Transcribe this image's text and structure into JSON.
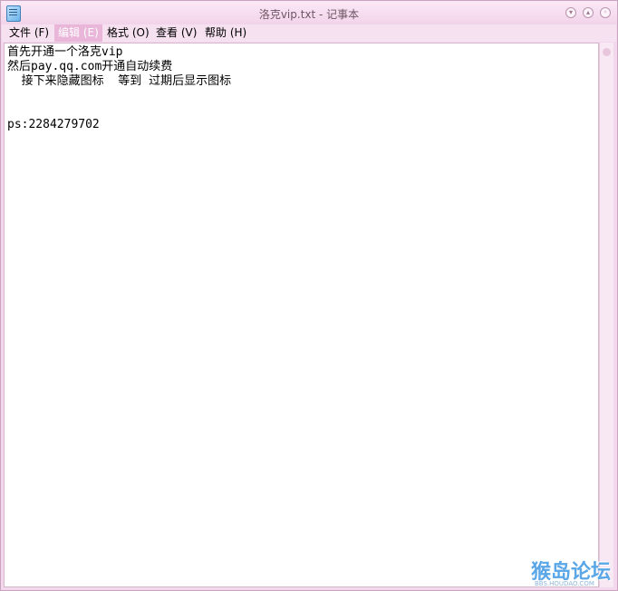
{
  "window": {
    "title": "洛克vip.txt - 记事本"
  },
  "menu": {
    "items": [
      "文件 (F)",
      "编辑 (E)",
      "格式 (O)",
      "查看 (V)",
      "帮助 (H)"
    ]
  },
  "document": {
    "lines": [
      "首先开通一个洛克vip",
      "然后pay.qq.com开通自动续费",
      "  接下来隐藏图标  等到 过期后显示图标",
      "",
      "",
      "ps:2284279702"
    ]
  },
  "watermark": {
    "text": "猴岛论坛",
    "subtext": "BBS.HOUDAO.COM"
  }
}
